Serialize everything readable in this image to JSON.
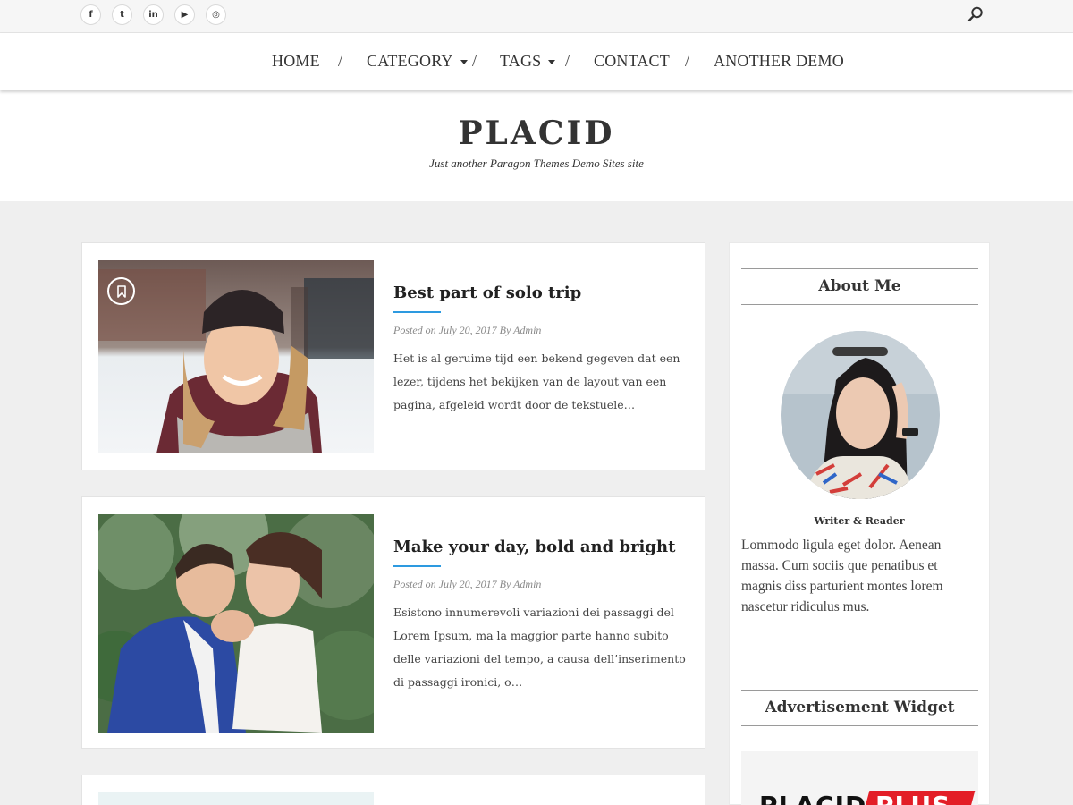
{
  "social": {
    "icons": [
      {
        "name": "facebook-icon",
        "glyph": "f"
      },
      {
        "name": "twitter-icon",
        "glyph": "t"
      },
      {
        "name": "linkedin-icon",
        "glyph": "in"
      },
      {
        "name": "youtube-icon",
        "glyph": "▶"
      },
      {
        "name": "instagram-icon",
        "glyph": "◎"
      }
    ]
  },
  "nav": {
    "items": [
      "HOME",
      "CATEGORY",
      "TAGS",
      "CONTACT",
      "ANOTHER DEMO"
    ],
    "separator": "/"
  },
  "site": {
    "title": "PLACID",
    "tagline": "Just another Paragon Themes Demo Sites site"
  },
  "posts": [
    {
      "title": "Best part of solo trip",
      "meta": "Posted on July 20, 2017   By Admin",
      "excerpt": "Het is al geruime tijd een bekend gegeven dat een lezer, tijdens het bekijken van de layout van een pagina, afgeleid wordt door de tekstuele…"
    },
    {
      "title": "Make your day, bold and bright",
      "meta": "Posted on July 20, 2017   By Admin",
      "excerpt": "Esistono innumerevoli variazioni dei passaggi del Lorem Ipsum, ma la maggior parte hanno subito delle variazioni del tempo, a causa dell’inserimento di passaggi ironici, o…"
    }
  ],
  "sidebar": {
    "about_title": "About Me",
    "avatar_caption": "Writer & Reader",
    "about_text": "Lommodo ligula eget dolor. Aenean massa. Cum sociis que penatibus et magnis diss parturient montes lorem nascetur ridiculus mus.",
    "ad_title": "Advertisement Widget",
    "ad_banner": {
      "brand": "PLACID",
      "badge": "PLUS"
    }
  },
  "colors": {
    "accent": "#2d9ae0",
    "ad_red": "#e31e27"
  }
}
